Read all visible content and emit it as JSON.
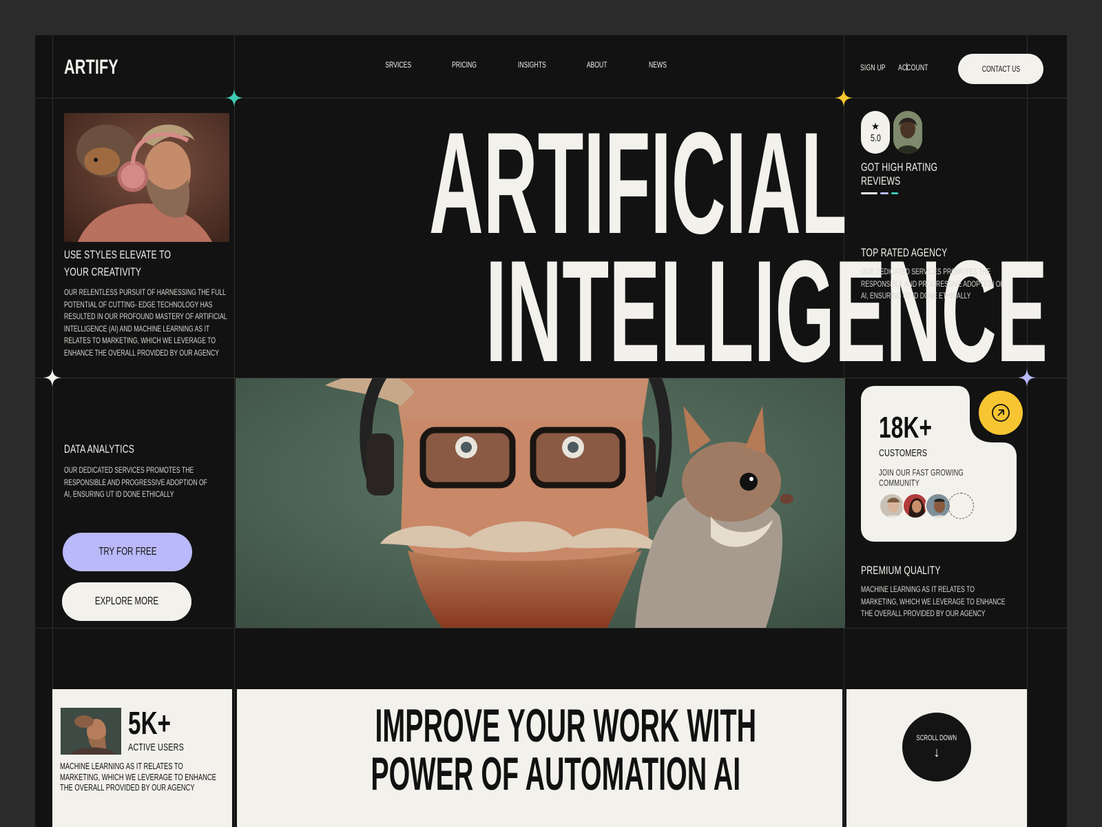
{
  "header": {
    "logo": "ARTIFY",
    "nav": [
      "SRVICES",
      "PRICING",
      "INSIGHTS",
      "ABOUT",
      "NEWS"
    ],
    "sign_up": "SIGN UP",
    "separator": "|",
    "account": "ACCOUNT",
    "contact": "CONTACT US"
  },
  "hero": {
    "line1": "ARTIFICIAL",
    "line2": "INTELLIGENCE"
  },
  "left": {
    "feature_title_1": "USE STYLES ELEVATE TO",
    "feature_title_2": "YOUR CREATIVITY",
    "feature_text": "OUR RELENTLESS PURSUIT OF HARNESSING THE FULL POTENTIAL OF CUTTING- EDGE TECHNOLOGY HAS RESULTED IN OUR PROFOUND MASTERY OF ARTIFICIAL INTELLIGENCE (AI) AND MACHINE LEARNING AS IT RELATES TO MARKETING, WHICH WE LEVERAGE TO ENHANCE THE OVERALL PROVIDED BY OUR AGENCY",
    "analytics_title": "DATA ANALYTICS",
    "analytics_text": "OUR DEDICATED SERVICES PROMOTES THE RESPONSIBLE AND PROGRESSIVE ADOPTION OF AI, ENSURING UT ID DONE ETHICALLY",
    "try_button": "TRY FOR FREE",
    "explore_button": "EXPLORE MORE"
  },
  "right": {
    "rating_star": "★",
    "rating_value": "5.0",
    "rating_title_1": "GOT HIGH RATING",
    "rating_title_2": "REVIEWS",
    "agency_title": "TOP RATED AGENCY",
    "agency_text": "OUR DEDICATED SERVICES PROMOTES THE RESPONSIBLE AND PROGRESSIVE ADOPTION OF AI, ENSURING UT ID DONE ETHICALLY",
    "customers_value": "18K+",
    "customers_label": "CUSTOMERS",
    "customers_text_1": "JOIN OUR FAST GROWING",
    "customers_text_2": "COMMUNITY",
    "arrow_icon": "arrow-up-right-icon",
    "quality_title": "PREMIUM QUALITY",
    "quality_text": "MACHINE LEARNING AS IT RELATES TO MARKETING, WHICH WE LEVERAGE TO ENHANCE THE OVERALL PROVIDED BY OUR AGENCY"
  },
  "bottom": {
    "users_value": "5K+",
    "users_label": "ACTIVE USERS",
    "users_text": "MACHINE LEARNING AS IT RELATES TO MARKETING, WHICH WE LEVERAGE TO ENHANCE THE OVERALL PROVIDED BY OUR AGENCY",
    "headline_1": "IMPROVE YOUR WORK WITH",
    "headline_2": "POWER OF AUTOMATION AI",
    "scroll_label": "SCROLL DOWN",
    "scroll_arrow": "↓"
  },
  "colors": {
    "background": "#121212",
    "cream": "#f3f1ec",
    "lavender": "#b9b9fb",
    "yellow": "#f7c531",
    "teal": "#3fc9b3"
  }
}
